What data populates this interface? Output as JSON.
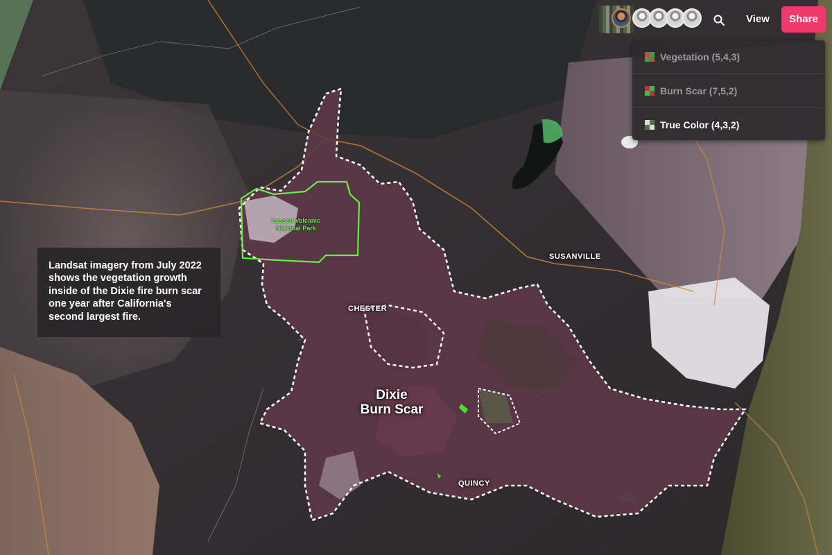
{
  "caption": {
    "text": "Landsat imagery from July 2022 shows the vegetation growth inside of the Dixie fire burn scar one year after California's second largest fire."
  },
  "map_labels": {
    "park": [
      "Lassen Volcanic",
      "National Park"
    ],
    "susanville": "SUSANVILLE",
    "chester": "CHESTER",
    "quincy": "QUINCY",
    "burn_scar": [
      "Dixie",
      "Burn Scar"
    ]
  },
  "toolbar": {
    "avatars": [
      "collaborator-photo",
      "collaborator",
      "collaborator",
      "collaborator",
      "collaborator"
    ],
    "view_label": "View",
    "share_label": "Share",
    "share_color": "#ee3a6a"
  },
  "band_menu": {
    "items": [
      {
        "label": "Vegetation (5,4,3)",
        "active": false,
        "colors": [
          "#c0503c",
          "#3aa050",
          "#c0503c",
          "#3aa050"
        ]
      },
      {
        "label": "Burn Scar (7,5,2)",
        "active": false,
        "colors": [
          "#c0303a",
          "#3ac050",
          "#c0303a",
          "#3ac050"
        ]
      },
      {
        "label": "True Color (4,3,2)",
        "active": true,
        "colors": [
          "#dddddd",
          "#4a7a4a",
          "#4a7a4a",
          "#dddddd"
        ]
      }
    ]
  },
  "colors": {
    "park_boundary": "#66ee44",
    "fire_perimeter": "#ffffff",
    "burn_scar": "#5e3848",
    "highway": "#d08a3a"
  }
}
